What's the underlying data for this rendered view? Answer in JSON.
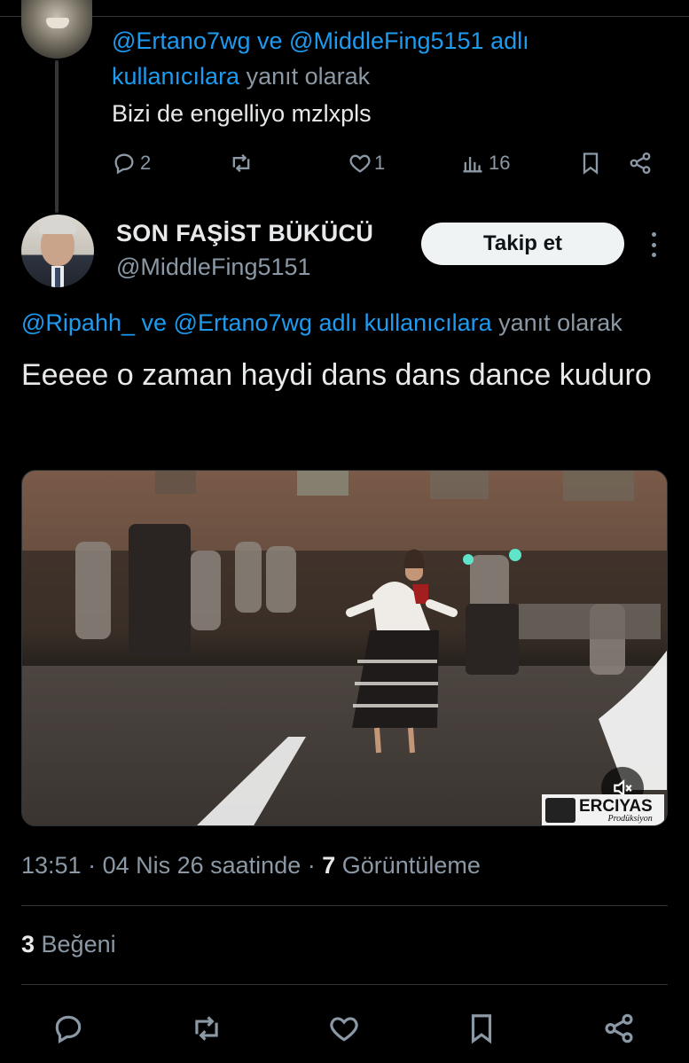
{
  "colors": {
    "background": "#000000",
    "text_primary": "#e7e9ea",
    "text_secondary": "#8b98a5",
    "mention": "#1d9bf0",
    "divider": "#2f3336"
  },
  "reply_tweet": {
    "reply_to_mention_1": "@Ertano7wg",
    "reply_to_conj": " ve ",
    "reply_to_mention_2": "@MiddleFing5151",
    "reply_to_suffix_blue": " adlı kullanıcılara",
    "reply_to_suffix": " yanıt olarak",
    "text": "Bizi de engelliyo mzlxpls",
    "actions": {
      "reply_count": "2",
      "like_count": "1",
      "views_count": "16"
    },
    "icons": [
      "reply-icon",
      "retweet-icon",
      "like-icon",
      "views-icon",
      "bookmark-icon",
      "share-icon"
    ]
  },
  "main_tweet": {
    "display_name": "SON FAŞİST BÜKÜCÜ",
    "handle": "@MiddleFing5151",
    "follow_label": "Takip et",
    "reply_to_mention_1": "@Ripahh_",
    "reply_to_conj": " ve ",
    "reply_to_mention_2": "@Ertano7wg",
    "reply_to_suffix_blue": " adlı kullanıcılara",
    "reply_to_suffix": " yanıt olarak",
    "text": "Eeeee o zaman haydi dans dans dance kuduro",
    "media": {
      "watermark_title": "ERCIYAS",
      "watermark_sub": "Prodüksiyon"
    },
    "meta": {
      "time": "13:51",
      "sep1": " · ",
      "date": "04 Nis 26 saatinde",
      "sep2": " · ",
      "views_count": "7",
      "views_label": " Görüntüleme"
    },
    "likes": {
      "count": "3",
      "label": " Beğeni"
    },
    "icons": [
      "reply-icon",
      "retweet-icon",
      "like-icon",
      "bookmark-icon",
      "share-icon"
    ]
  }
}
